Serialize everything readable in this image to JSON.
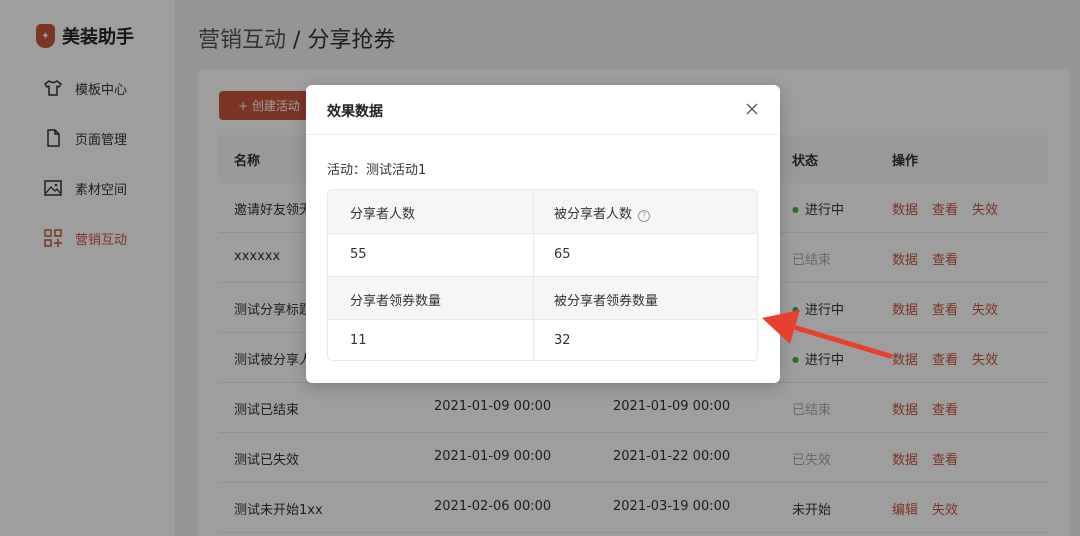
{
  "brand": {
    "name": "美装助手"
  },
  "sidebar": {
    "items": [
      {
        "label": "模板中心",
        "icon": "shirt-icon"
      },
      {
        "label": "页面管理",
        "icon": "file-icon"
      },
      {
        "label": "素材空间",
        "icon": "image-icon"
      },
      {
        "label": "营销互动",
        "icon": "grid-icon"
      }
    ]
  },
  "header": {
    "parent": "营销互动",
    "separator": "/",
    "current": "分享抢券"
  },
  "toolbar": {
    "create_label": "+ 创建活动"
  },
  "table": {
    "columns": [
      "名称",
      "状态",
      "操作"
    ],
    "rows": [
      {
        "name": "邀请好友领无",
        "start": "",
        "end": "",
        "status": "进行中",
        "actions": [
          "数据",
          "查看",
          "失效"
        ]
      },
      {
        "name": "xxxxxx",
        "start": "",
        "end": "",
        "status": "已结束",
        "actions": [
          "数据",
          "查看"
        ]
      },
      {
        "name": "测试分享标题",
        "start": "",
        "end": "",
        "status": "进行中",
        "actions": [
          "数据",
          "查看",
          "失效"
        ]
      },
      {
        "name": "测试被分享人",
        "start": "",
        "end": "",
        "status": "进行中",
        "actions": [
          "数据",
          "查看",
          "失效"
        ]
      },
      {
        "name": "测试已结束",
        "start": "2021-01-09 00:00",
        "end": "2021-01-09 00:00",
        "status": "已结束",
        "actions": [
          "数据",
          "查看"
        ]
      },
      {
        "name": "测试已失效",
        "start": "2021-01-09 00:00",
        "end": "2021-01-22 00:00",
        "status": "已失效",
        "actions": [
          "数据",
          "查看"
        ]
      },
      {
        "name": "测试未开始1xx",
        "start": "2021-02-06 00:00",
        "end": "2021-03-19 00:00",
        "status": "未开始",
        "actions": [
          "编辑",
          "失效"
        ]
      }
    ]
  },
  "modal": {
    "title": "效果数据",
    "activity_label": "活动：测试活动1",
    "stats": {
      "sharers_label": "分享者人数",
      "sharers_value": "55",
      "shared_label": "被分享者人数",
      "shared_value": "65",
      "sharer_coupons_label": "分享者领券数量",
      "sharer_coupons_value": "11",
      "shared_coupons_label": "被分享者领券数量",
      "shared_coupons_value": "32"
    }
  },
  "colors": {
    "accent": "#c8553d",
    "running": "#4caf50",
    "arrow": "#e8402f"
  }
}
